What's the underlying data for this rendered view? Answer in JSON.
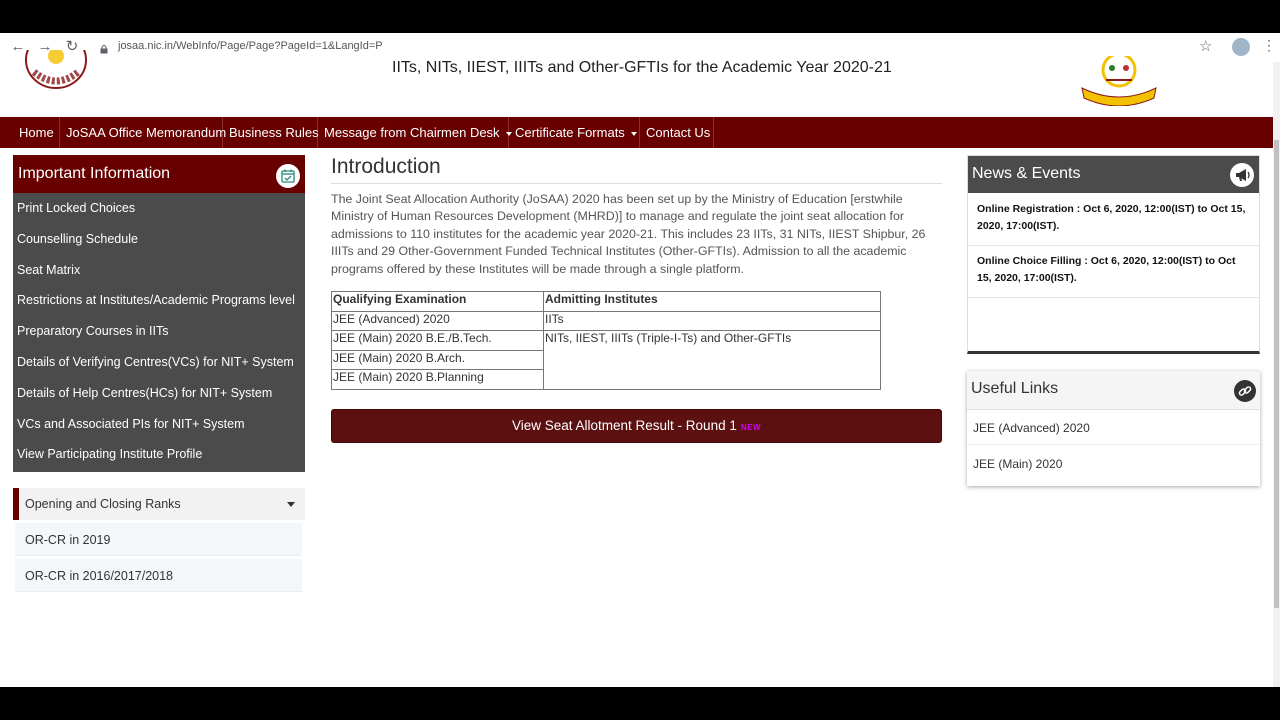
{
  "browser": {
    "url": "josaa.nic.in/WebInfo/Page/Page?PageId=1&LangId=P"
  },
  "header": {
    "title": "IITs, NITs, IIEST, IIITs and Other-GFTIs for the Academic Year 2020-21"
  },
  "menu": {
    "items": [
      {
        "label": "Home"
      },
      {
        "label": "JoSAA Office Memorandum"
      },
      {
        "label": "Business Rules"
      },
      {
        "label": "Message from Chairmen Desk"
      },
      {
        "label": "Certificate Formats"
      },
      {
        "label": "Contact Us"
      }
    ]
  },
  "info": {
    "title": "Important Information",
    "links": [
      "Print Locked Choices",
      "Counselling Schedule",
      "Seat Matrix",
      "Restrictions at Institutes/Academic Programs level",
      "Preparatory Courses in IITs",
      "Details of Verifying Centres(VCs) for NIT+ System",
      "Details of Help Centres(HCs) for NIT+ System",
      "VCs and Associated PIs for NIT+ System",
      "View Participating Institute Profile"
    ]
  },
  "ranks": {
    "title": "Opening and Closing Ranks",
    "items": [
      "OR-CR in 2019",
      "OR-CR in 2016/2017/2018"
    ]
  },
  "intro": {
    "title": "Introduction",
    "text": "The Joint Seat Allocation Authority (JoSAA) 2020 has been set up by the Ministry of Education [erstwhile Ministry of Human Resources Development (MHRD)] to manage and regulate the joint seat allocation for admissions to 110 institutes for the academic year 2020-21. This includes 23 IITs,  31 NITs, IIEST Shipbur, 26 IIITs and 29 Other-Government Funded Technical Institutes (Other-GFTIs). Admission to all the academic programs offered by these Institutes will be made through a single platform."
  },
  "table": {
    "headers": [
      "Qualifying Examination",
      "Admitting Institutes"
    ],
    "exams": [
      "JEE (Advanced) 2020",
      "JEE (Main) 2020 B.E./B.Tech.",
      "JEE (Main) 2020 B.Arch.",
      "JEE (Main) 2020 B.Planning"
    ],
    "institutes": [
      "IITs",
      "NITs, IIEST, IIITs (Triple-I-Ts) and Other-GFTIs"
    ]
  },
  "result_button": {
    "label": "View Seat Allotment Result - Round 1",
    "badge": "NEW"
  },
  "news": {
    "title": "News & Events",
    "items": [
      "Online Registration : Oct 6, 2020, 12:00(IST) to Oct 15, 2020, 17:00(IST).",
      "Online Choice Filling : Oct 6, 2020, 12:00(IST) to Oct 15, 2020, 17:00(IST)."
    ]
  },
  "useful": {
    "title": "Useful Links",
    "links": [
      "JEE (Advanced) 2020",
      "JEE (Main) 2020"
    ]
  },
  "colors": {
    "maroon": "#680000",
    "panel_gray": "#4b4b4b",
    "button": "#5c1010"
  }
}
